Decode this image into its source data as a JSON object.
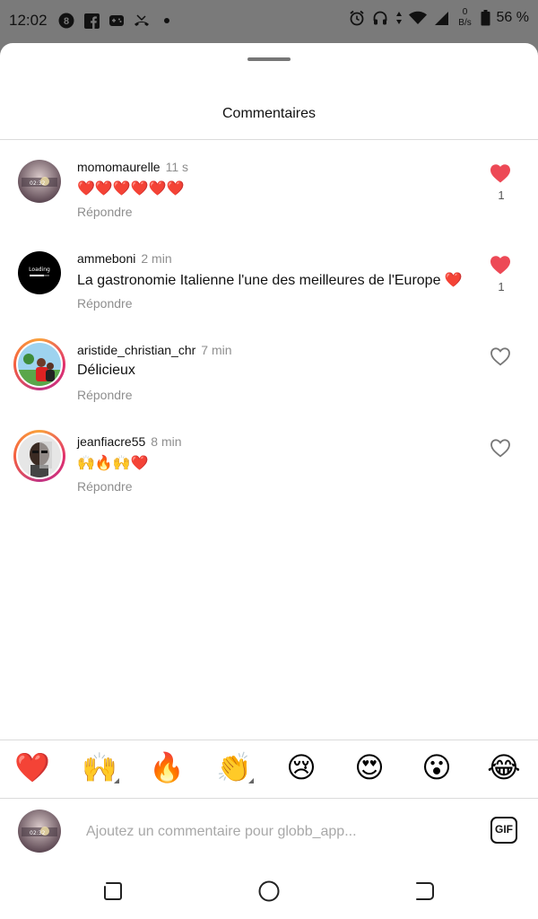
{
  "status_bar": {
    "time": "12:02",
    "net_speed_value": "0",
    "net_speed_unit": "B/s",
    "battery": "56 %",
    "left_icons": [
      "circle-8-icon",
      "facebook-icon",
      "gamepad-icon",
      "missed-call-icon",
      "dot-icon"
    ],
    "right_icons": [
      "alarm-icon",
      "headphones-icon",
      "data-arrows-icon",
      "wifi-icon",
      "signal-icon",
      "battery-icon"
    ]
  },
  "sheet": {
    "title": "Commentaires"
  },
  "comments": [
    {
      "username": "momomaurelle",
      "time": "11 s",
      "text": "❤️❤️❤️❤️❤️❤️",
      "reply": "Répondre",
      "liked": true,
      "likes": "1"
    },
    {
      "username": "ammeboni",
      "time": "2 min",
      "text": "La gastronomie Italienne l'une des meilleures de l'Europe ❤️",
      "reply": "Répondre",
      "liked": true,
      "likes": "1"
    },
    {
      "username": "aristide_christian_chr",
      "time": "7 min",
      "text": "Délicieux",
      "reply": "Répondre",
      "liked": false
    },
    {
      "username": "jeanfiacre55",
      "time": "8 min",
      "text": "🙌🔥🙌❤️",
      "reply": "Répondre",
      "liked": false
    }
  ],
  "avatar_text": {
    "momomaurelle": "02:32",
    "ammeboni": "Loading"
  },
  "emoji_bar": [
    "❤️",
    "🙌",
    "🔥",
    "👏",
    "😢",
    "😍",
    "😮",
    "😂"
  ],
  "input": {
    "placeholder": "Ajoutez un commentaire pour globb_app...",
    "gif_label": "GIF"
  },
  "colors": {
    "like_red": "#ed4956",
    "muted_text": "#8e8e8e",
    "divider": "#dbdbdb"
  }
}
